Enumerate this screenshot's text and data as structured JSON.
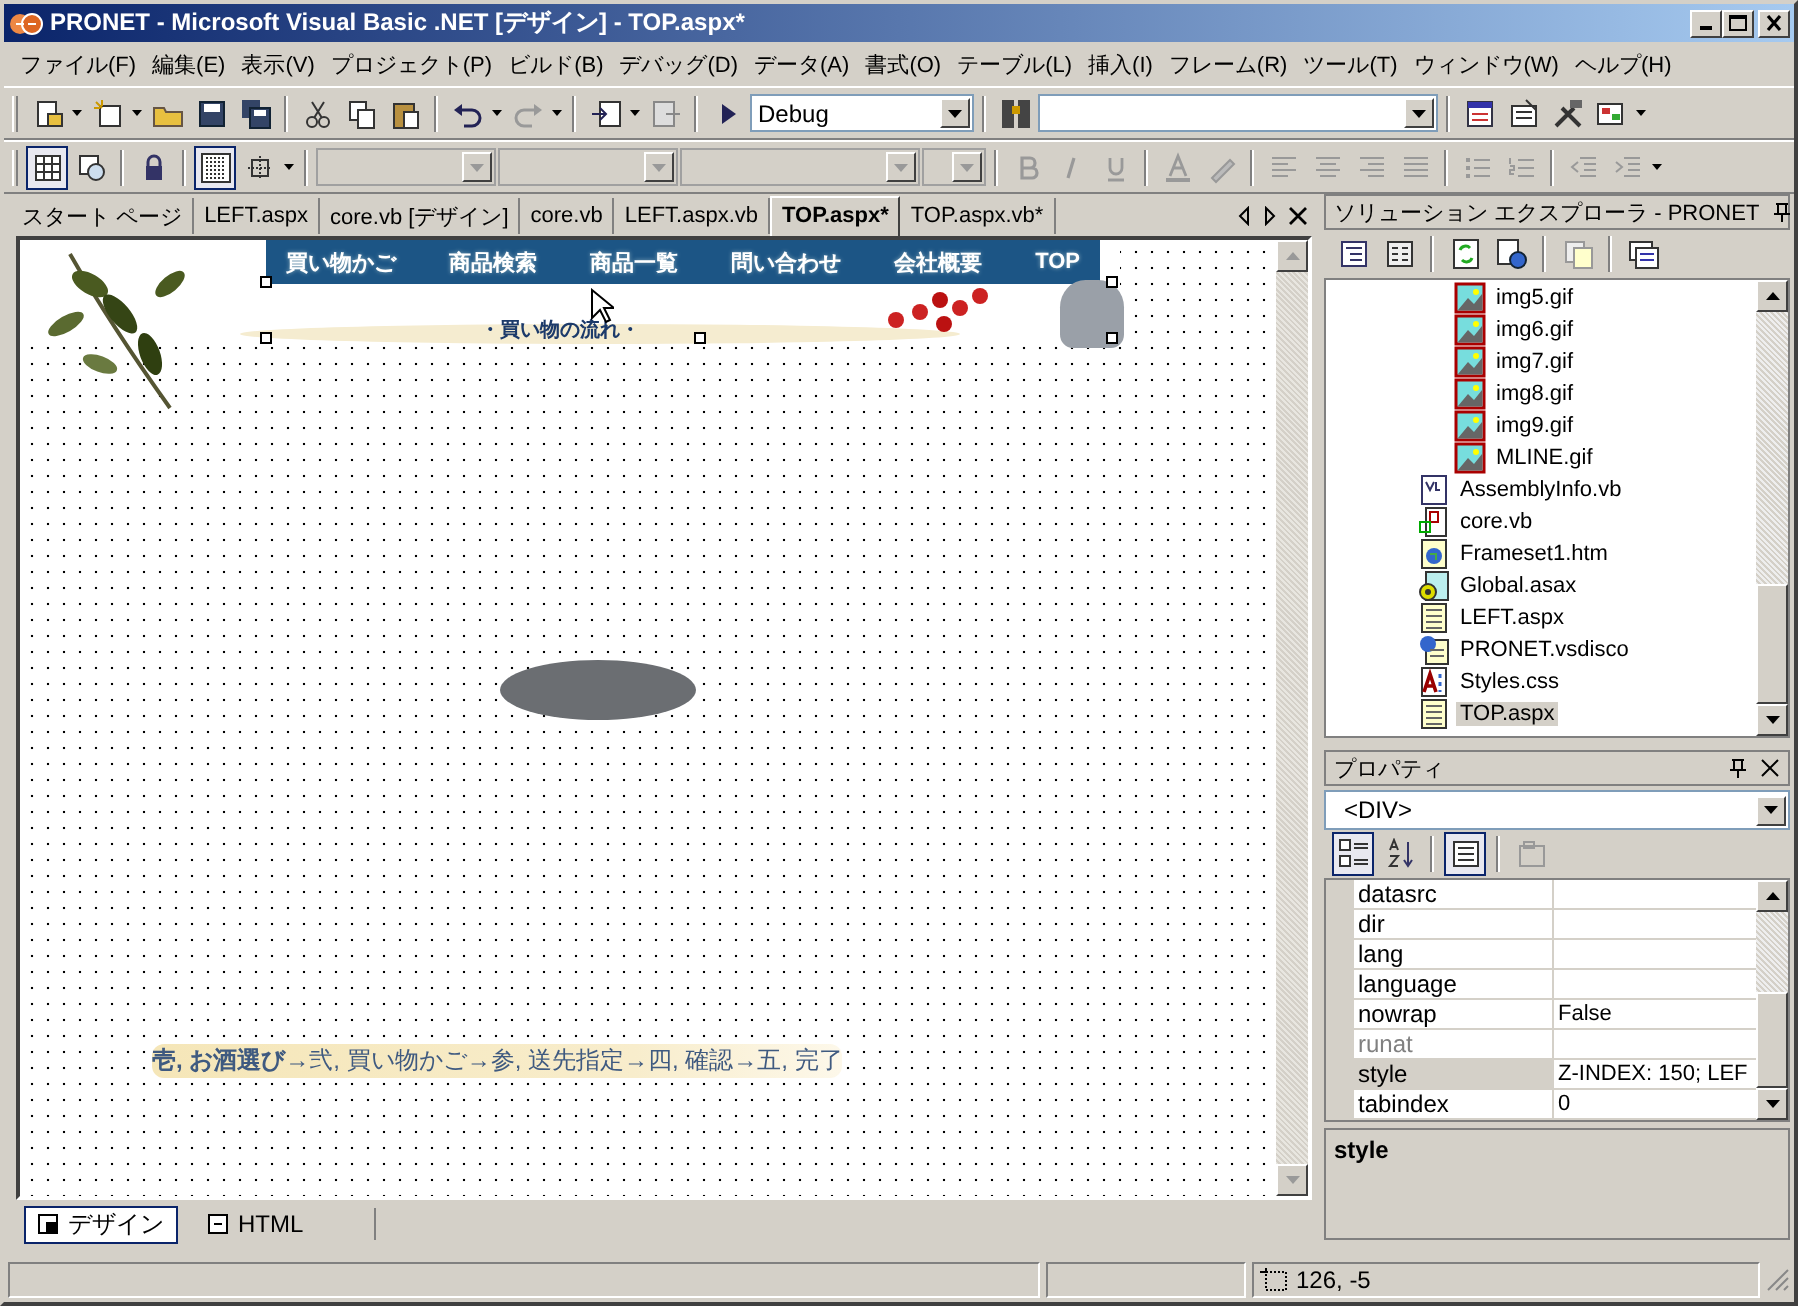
{
  "window": {
    "title": "PRONET - Microsoft Visual Basic .NET [デザイン] - TOP.aspx*"
  },
  "menu": [
    "ファイル(F)",
    "編集(E)",
    "表示(V)",
    "プロジェクト(P)",
    "ビルド(B)",
    "デバッグ(D)",
    "データ(A)",
    "書式(O)",
    "テーブル(L)",
    "挿入(I)",
    "フレーム(R)",
    "ツール(T)",
    "ウィンドウ(W)",
    "ヘルプ(H)"
  ],
  "toolbar": {
    "configuration": "Debug"
  },
  "doc_tabs": [
    {
      "label": "スタート ページ",
      "selected": false
    },
    {
      "label": "LEFT.aspx",
      "selected": false
    },
    {
      "label": "core.vb [デザイン]",
      "selected": false
    },
    {
      "label": "core.vb",
      "selected": false
    },
    {
      "label": "LEFT.aspx.vb",
      "selected": false
    },
    {
      "label": "TOP.aspx*",
      "selected": true
    },
    {
      "label": "TOP.aspx.vb*",
      "selected": false
    }
  ],
  "designer": {
    "nav_links": [
      "買い物かご",
      "商品検索",
      "商品一覧",
      "問い合わせ",
      "会社概要",
      "TOP"
    ],
    "subtitle": "・買い物の流れ・",
    "steps": "**壱, お酒選び**→弐, 買い物かご→参, 送先指定→四, 確認→五, 完了"
  },
  "view_tabs": [
    {
      "label": "デザイン",
      "selected": true
    },
    {
      "label": "HTML",
      "selected": false
    }
  ],
  "solution_explorer": {
    "title": "ソリューション エクスプローラ - PRONET",
    "nested_items": [
      {
        "label": "img5.gif",
        "kind": "image",
        "selected": false
      },
      {
        "label": "img6.gif",
        "kind": "image",
        "selected": false
      },
      {
        "label": "img7.gif",
        "kind": "image",
        "selected": false
      },
      {
        "label": "img8.gif",
        "kind": "image",
        "selected": false
      },
      {
        "label": "img9.gif",
        "kind": "image",
        "selected": false
      },
      {
        "label": "MLINE.gif",
        "kind": "image",
        "selected": false
      }
    ],
    "items": [
      {
        "label": "AssemblyInfo.vb",
        "kind": "vb",
        "selected": false
      },
      {
        "label": "core.vb",
        "kind": "class",
        "selected": false
      },
      {
        "label": "Frameset1.htm",
        "kind": "html",
        "selected": false
      },
      {
        "label": "Global.asax",
        "kind": "asax",
        "selected": false
      },
      {
        "label": "LEFT.aspx",
        "kind": "aspx",
        "selected": false
      },
      {
        "label": "PRONET.vsdisco",
        "kind": "disco",
        "selected": false
      },
      {
        "label": "Styles.css",
        "kind": "css",
        "selected": false
      },
      {
        "label": "TOP.aspx",
        "kind": "aspx",
        "selected": true
      }
    ]
  },
  "properties": {
    "title": "プロパティ",
    "object": "<DIV>",
    "rows": [
      {
        "name": "datasrc",
        "value": null,
        "disabled": false,
        "selected": false
      },
      {
        "name": "dir",
        "value": null,
        "disabled": false,
        "selected": false
      },
      {
        "name": "lang",
        "value": null,
        "disabled": false,
        "selected": false
      },
      {
        "name": "language",
        "value": null,
        "disabled": false,
        "selected": false
      },
      {
        "name": "nowrap",
        "value": "False",
        "disabled": false,
        "selected": false
      },
      {
        "name": "runat",
        "value": null,
        "disabled": true,
        "selected": false
      },
      {
        "name": "style",
        "value": "Z-INDEX: 150; LEF",
        "disabled": false,
        "selected": true
      },
      {
        "name": "tabindex",
        "value": "0",
        "disabled": false,
        "selected": false
      }
    ],
    "description": "style"
  },
  "status_bar": {
    "position": "126, -5"
  }
}
